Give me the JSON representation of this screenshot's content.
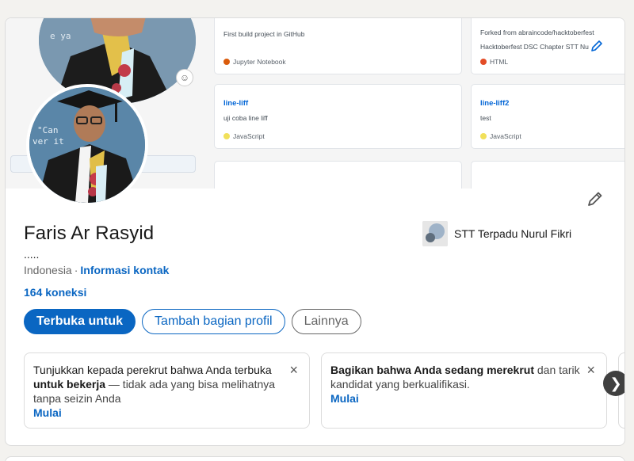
{
  "banner": {
    "repos": [
      {
        "title": "",
        "desc": "First build project in GitHub",
        "lang": "Jupyter Notebook",
        "lang_color": "#da5b0b"
      },
      {
        "title": "",
        "desc": "Forked from abraincode/hacktoberfest",
        "desc2": "Hacktoberfest DSC Chapter STT Nu",
        "lang": "HTML",
        "lang_color": "#e34c26"
      },
      {
        "title": "line-liff",
        "desc": "uji coba line liff",
        "lang": "JavaScript",
        "lang_color": "#f1e05a"
      },
      {
        "title": "line-liff2",
        "desc": "test",
        "lang": "JavaScript",
        "lang_color": "#f1e05a"
      }
    ],
    "photo_text_big": "e ya",
    "photo_text_small": "\"Can",
    "photo_text_small2": "ver it"
  },
  "profile": {
    "name": "Faris Ar Rasyid",
    "headline": ".....",
    "location": "Indonesia",
    "separator": "·",
    "contact_link": "Informasi kontak",
    "connections": "164 koneksi",
    "education": "STT Terpadu Nurul Fikri"
  },
  "actions": {
    "primary": "Terbuka untuk",
    "add_section": "Tambah bagian profil",
    "more": "Lainnya"
  },
  "promos": [
    {
      "text_plain": "Tunjukkan kepada perekrut bahwa Anda terbuka ",
      "text_bold": "untuk bekerja",
      "text_rest": " — tidak ada yang bisa melihatnya tanpa seizin Anda",
      "cta": "Mulai"
    },
    {
      "text_bold": "Bagikan bahwa Anda sedang merekrut",
      "text_rest": " dan tarik kandidat yang berkualifikasi.",
      "cta": "Mulai"
    }
  ],
  "icons": {
    "close": "×",
    "next": "❯",
    "emoji": "☺"
  },
  "colors": {
    "accent": "#0a66c2",
    "text": "#191919",
    "muted": "#666666"
  }
}
